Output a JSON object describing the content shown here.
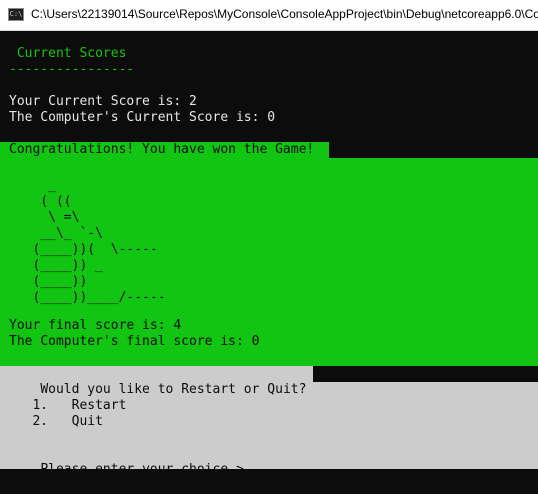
{
  "window": {
    "title": "C:\\Users\\22139014\\Source\\Repos\\MyConsole\\ConsoleAppProject\\bin\\Debug\\netcoreapp6.0\\Co",
    "icon": "C:\\"
  },
  "header": {
    "heading": " Current Scores",
    "underline": "----------------"
  },
  "scores": {
    "current_player": "Your Current Score is: 2",
    "current_computer": "The Computer's Current Score is: 0"
  },
  "result": {
    "message": "Congratulations! You have won the Game! ",
    "ascii_art": "     _\n    ( ((\n     \\ =\\\n    __\\_ `-\\\n   (____))(  \\-----\n   (____)) _\n   (____))\n   (____))____/-----",
    "final_player": "Your final score is: 4",
    "final_computer": "The Computer's final score is: 0"
  },
  "prompt": {
    "question": "Would you like to Restart or Quit?",
    "options": [
      "   1.   Restart",
      "   2.   Quit"
    ],
    "input_prompt": "Please enter your choice > "
  },
  "colors": {
    "console_bg": "#0c0c0c",
    "text": "#cccccc",
    "heading_green": "#16c60c",
    "win_green": "#13c513",
    "menu_gray": "#cccccc"
  }
}
